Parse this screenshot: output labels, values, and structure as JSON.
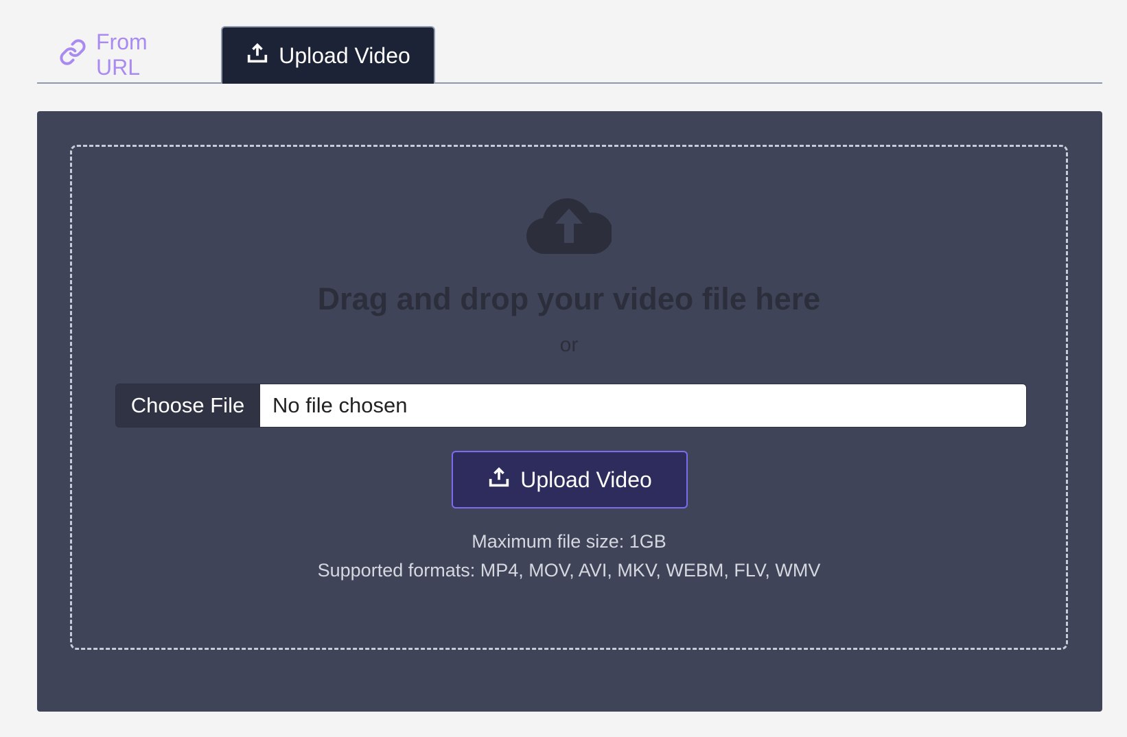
{
  "tabs": [
    {
      "label": "From URL",
      "icon": "link-icon",
      "active": false
    },
    {
      "label": "Upload Video",
      "icon": "upload-icon",
      "active": true
    }
  ],
  "dropzone": {
    "icon": "cloud-upload-icon",
    "title": "Drag and drop your video file here",
    "or_text": "or"
  },
  "file_input": {
    "button_label": "Choose File",
    "status": "No file chosen"
  },
  "upload_button": {
    "label": "Upload Video",
    "icon": "upload-icon"
  },
  "info": {
    "max_size": "Maximum file size: 1GB",
    "formats": "Supported formats: MP4, MOV, AVI, MKV, WEBM, FLV, WMV"
  },
  "colors": {
    "page_bg": "#f4f4f4",
    "panel_bg": "#3f4459",
    "active_tab_bg": "#1d2336",
    "inactive_tab_text": "#a98af0",
    "upload_btn_bg": "#2e2c5c",
    "upload_btn_border": "#7d6cf0"
  }
}
